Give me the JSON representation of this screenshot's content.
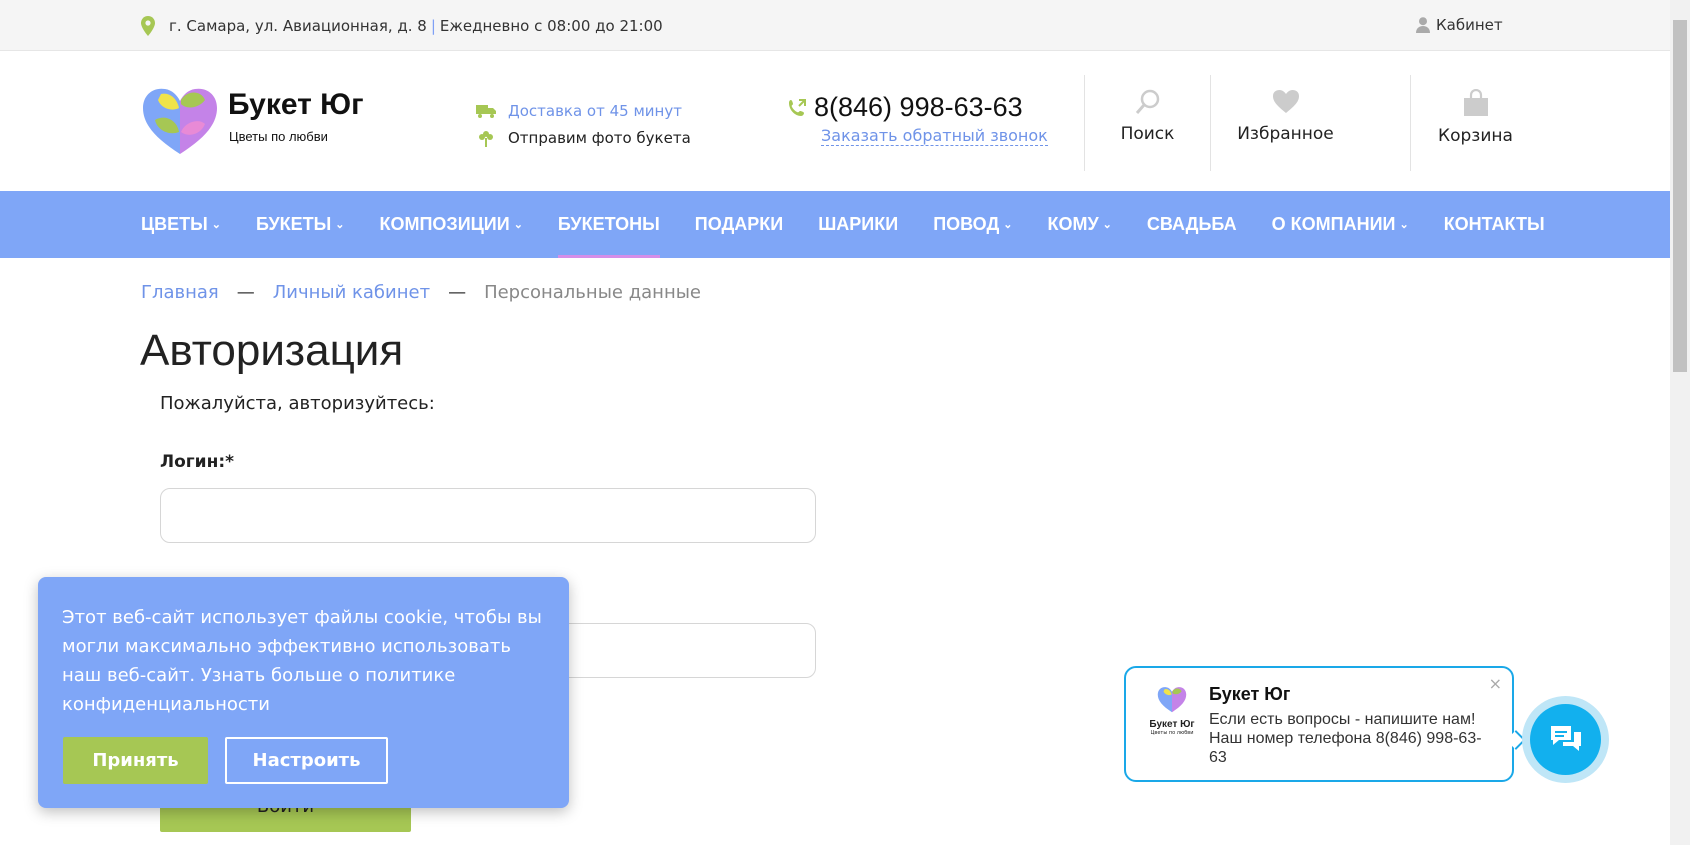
{
  "topbar": {
    "address": "г. Самара, ул. Авиационная, д. 8",
    "separator": "|",
    "hours": "Ежедневно с 08:00 до 21:00",
    "cabinet_label": "Кабинет"
  },
  "header": {
    "brand": "Букет Юг",
    "tagline": "Цветы по любви",
    "delivery_link": "Доставка от 45 минут",
    "photo_note": "Отправим фото букета",
    "phone": "8(846) 998-63-63",
    "callback_link": "Заказать обратный звонок",
    "search_label": "Поиск",
    "favorites_label": "Избранное",
    "cart_label": "Корзина"
  },
  "nav": {
    "items": [
      {
        "label": "Цветы",
        "dropdown": true
      },
      {
        "label": "Букеты",
        "dropdown": true
      },
      {
        "label": "Композиции",
        "dropdown": true
      },
      {
        "label": "Букетоны",
        "dropdown": false,
        "active": true
      },
      {
        "label": "Подарки",
        "dropdown": false
      },
      {
        "label": "Шарики",
        "dropdown": false
      },
      {
        "label": "Повод",
        "dropdown": true
      },
      {
        "label": "Кому",
        "dropdown": true
      },
      {
        "label": "Свадьба",
        "dropdown": false
      },
      {
        "label": "О компании",
        "dropdown": true
      },
      {
        "label": "Контакты",
        "dropdown": false
      }
    ],
    "chevron": "⌄"
  },
  "breadcrumb": {
    "home": "Главная",
    "account": "Личный кабинет",
    "current": "Персональные данные",
    "separator": "—"
  },
  "auth": {
    "title": "Авторизация",
    "intro": "Пожалуйста, авторизуйтесь:",
    "login_label": "Логин:*",
    "login_value": "",
    "password_value": "",
    "submit_label": "Войти"
  },
  "cookie": {
    "text": "Этот веб-сайт использует файлы cookie, чтобы вы могли максимально эффективно использовать наш веб-сайт. Узнать больше о политике конфиденциальности",
    "accept_label": "Принять",
    "settings_label": "Настроить"
  },
  "chat": {
    "brand": "Букет Юг",
    "logo_tag": "Цветы по любви",
    "title": "Букет Юг",
    "message": "Если есть вопросы - напишите нам! Наш номер телефона 8(846) 998-63-63",
    "close": "×"
  },
  "colors": {
    "accent_blue": "#7fa6f7",
    "link_blue": "#6f93e8",
    "green": "#a6c754",
    "chat_blue": "#12b0ee"
  }
}
